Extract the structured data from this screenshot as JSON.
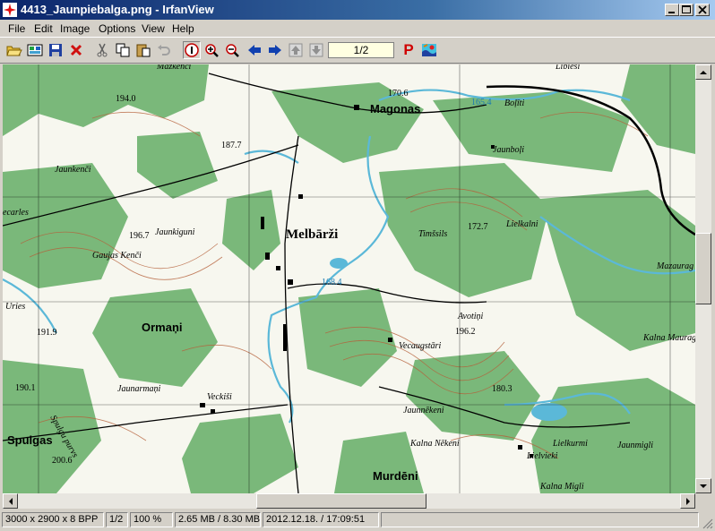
{
  "window": {
    "title": "4413_Jaunpiebalga.png - IrfanView"
  },
  "menu": [
    "File",
    "Edit",
    "Image",
    "Options",
    "View",
    "Help"
  ],
  "toolbar": {
    "page_indicator": "1/2",
    "p_label": "P",
    "icons": [
      "open-icon",
      "thumbnails-icon",
      "save-icon",
      "delete-icon",
      "cut-icon",
      "copy-icon",
      "paste-icon",
      "undo-icon",
      "info-icon",
      "zoom-in-icon",
      "zoom-out-icon",
      "previous-icon",
      "next-icon",
      "previous-page-icon",
      "next-page-icon",
      "plugin-icon",
      "irfanview-logo-icon"
    ]
  },
  "map": {
    "labels": {
      "melbarzi": "Melbārži",
      "magonas": "Magonas",
      "ormani": "Ormaņi",
      "spulgas": "Spulgas",
      "murdeni": "Murdēni",
      "jaunkenci": "Jaunkenči",
      "jaunkiguni": "Jaunkiguni",
      "gaujas_kenci": "Gaujas Kenči",
      "jaunboli": "Jaunboļi",
      "boliti": "Boļīti",
      "lielkalni": "Lielkalni",
      "timsisis": "Timšsils",
      "avotini": "Avotiņi",
      "vecaugstari": "Vecaugstāri",
      "jaunnekeni": "Jaunnēkeni",
      "kalna_nekeni": "Kalna Nēkeni",
      "lielvieki": "Lielvieki",
      "lielkurmi": "Lielkurmi",
      "jaunmigli": "Jaunmigli",
      "kalna_migli": "Kalna Migli",
      "mazaurage": "Mazaurag",
      "kalna_maurage": "Kalna Maurag",
      "veckisi": "Veckiši",
      "jaunarmani": "Jaunarmaņi",
      "urles": "Uries",
      "libiesi": "Libieši",
      "mazkenci": "Mazkenči",
      "carles": "ecarles",
      "purvs": "Spulgu purvs",
      "h1940": "194.0",
      "h1877": "187.7",
      "h1706": "170.6",
      "h1654": "165.4",
      "h1967": "196.7",
      "h1684": "168.4",
      "h1727": "172.7",
      "h1919": "191.9",
      "h1962": "196.2",
      "h1901": "190.1",
      "h1803": "180.3",
      "h2006": "200.6"
    }
  },
  "status": {
    "dimensions": "3000 x 2900 x 8 BPP",
    "page": "1/2",
    "zoom": "100 %",
    "size": "2.65 MB / 8.30 MB",
    "datetime": "2012.12.18. / 17:09:51"
  },
  "colors": {
    "titlebar": "#0a246a",
    "map_green": "#7ab87a",
    "map_water": "#5bb8d8",
    "contour": "#b5603a"
  }
}
